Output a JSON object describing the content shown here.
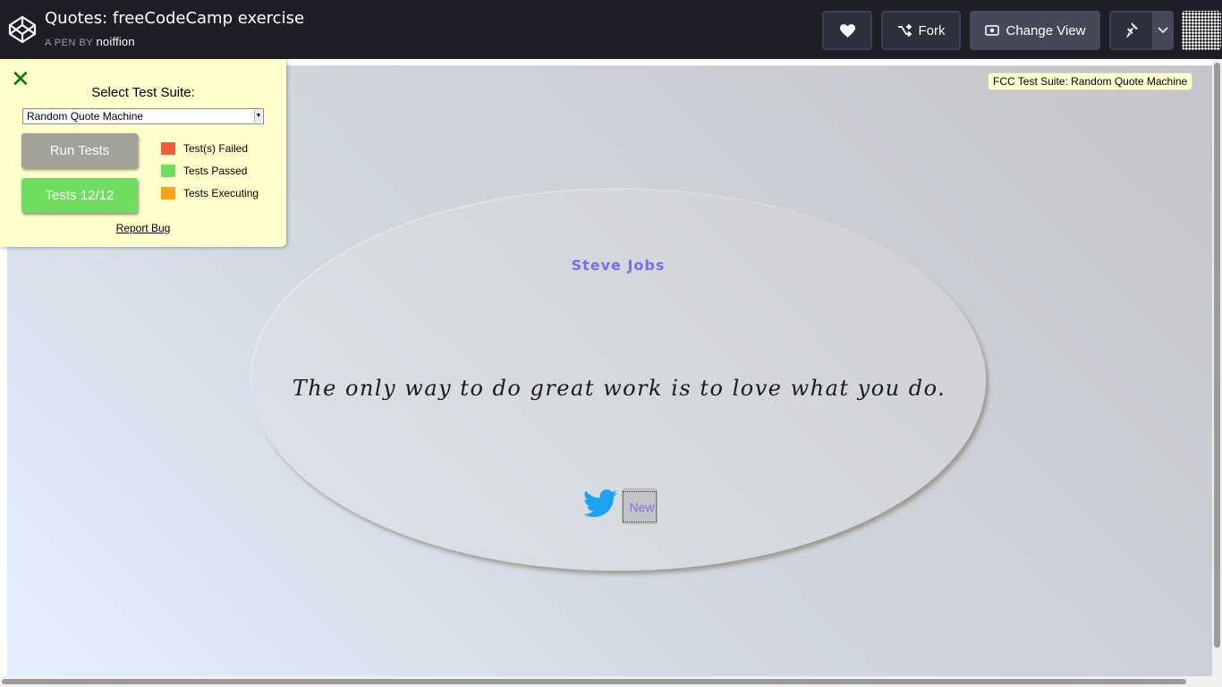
{
  "header": {
    "title": "Quotes: freeCodeCamp exercise",
    "byline_prefix": "A PEN BY",
    "author": "noiffion",
    "buttons": {
      "fork": "Fork",
      "change_view": "Change View"
    }
  },
  "test_suite": {
    "label": "Select Test Suite:",
    "selected_suite": "Random Quote Machine",
    "run_button": "Run Tests",
    "result_button": "Tests 12/12",
    "legend": [
      {
        "label": "Test(s) Failed",
        "color": "#f45a3d"
      },
      {
        "label": "Tests Passed",
        "color": "#6fdd60"
      },
      {
        "label": "Tests Executing",
        "color": "#ffa114"
      }
    ],
    "report_bug": "Report Bug"
  },
  "tooltip": "FCC Test Suite: Random Quote Machine",
  "quote_box": {
    "author": "Steve Jobs",
    "text": "The only way to do great work is to love what you do.",
    "new_button": "New"
  },
  "colors": {
    "accent": "#7b6df0",
    "header_bg": "#1e1f26",
    "twitter": "#1da1f2"
  },
  "icons": [
    "codepen-logo-icon",
    "heart-icon",
    "fork-icon",
    "eye-icon",
    "pin-icon",
    "chevron-down-icon",
    "close-icon",
    "twitter-icon"
  ]
}
